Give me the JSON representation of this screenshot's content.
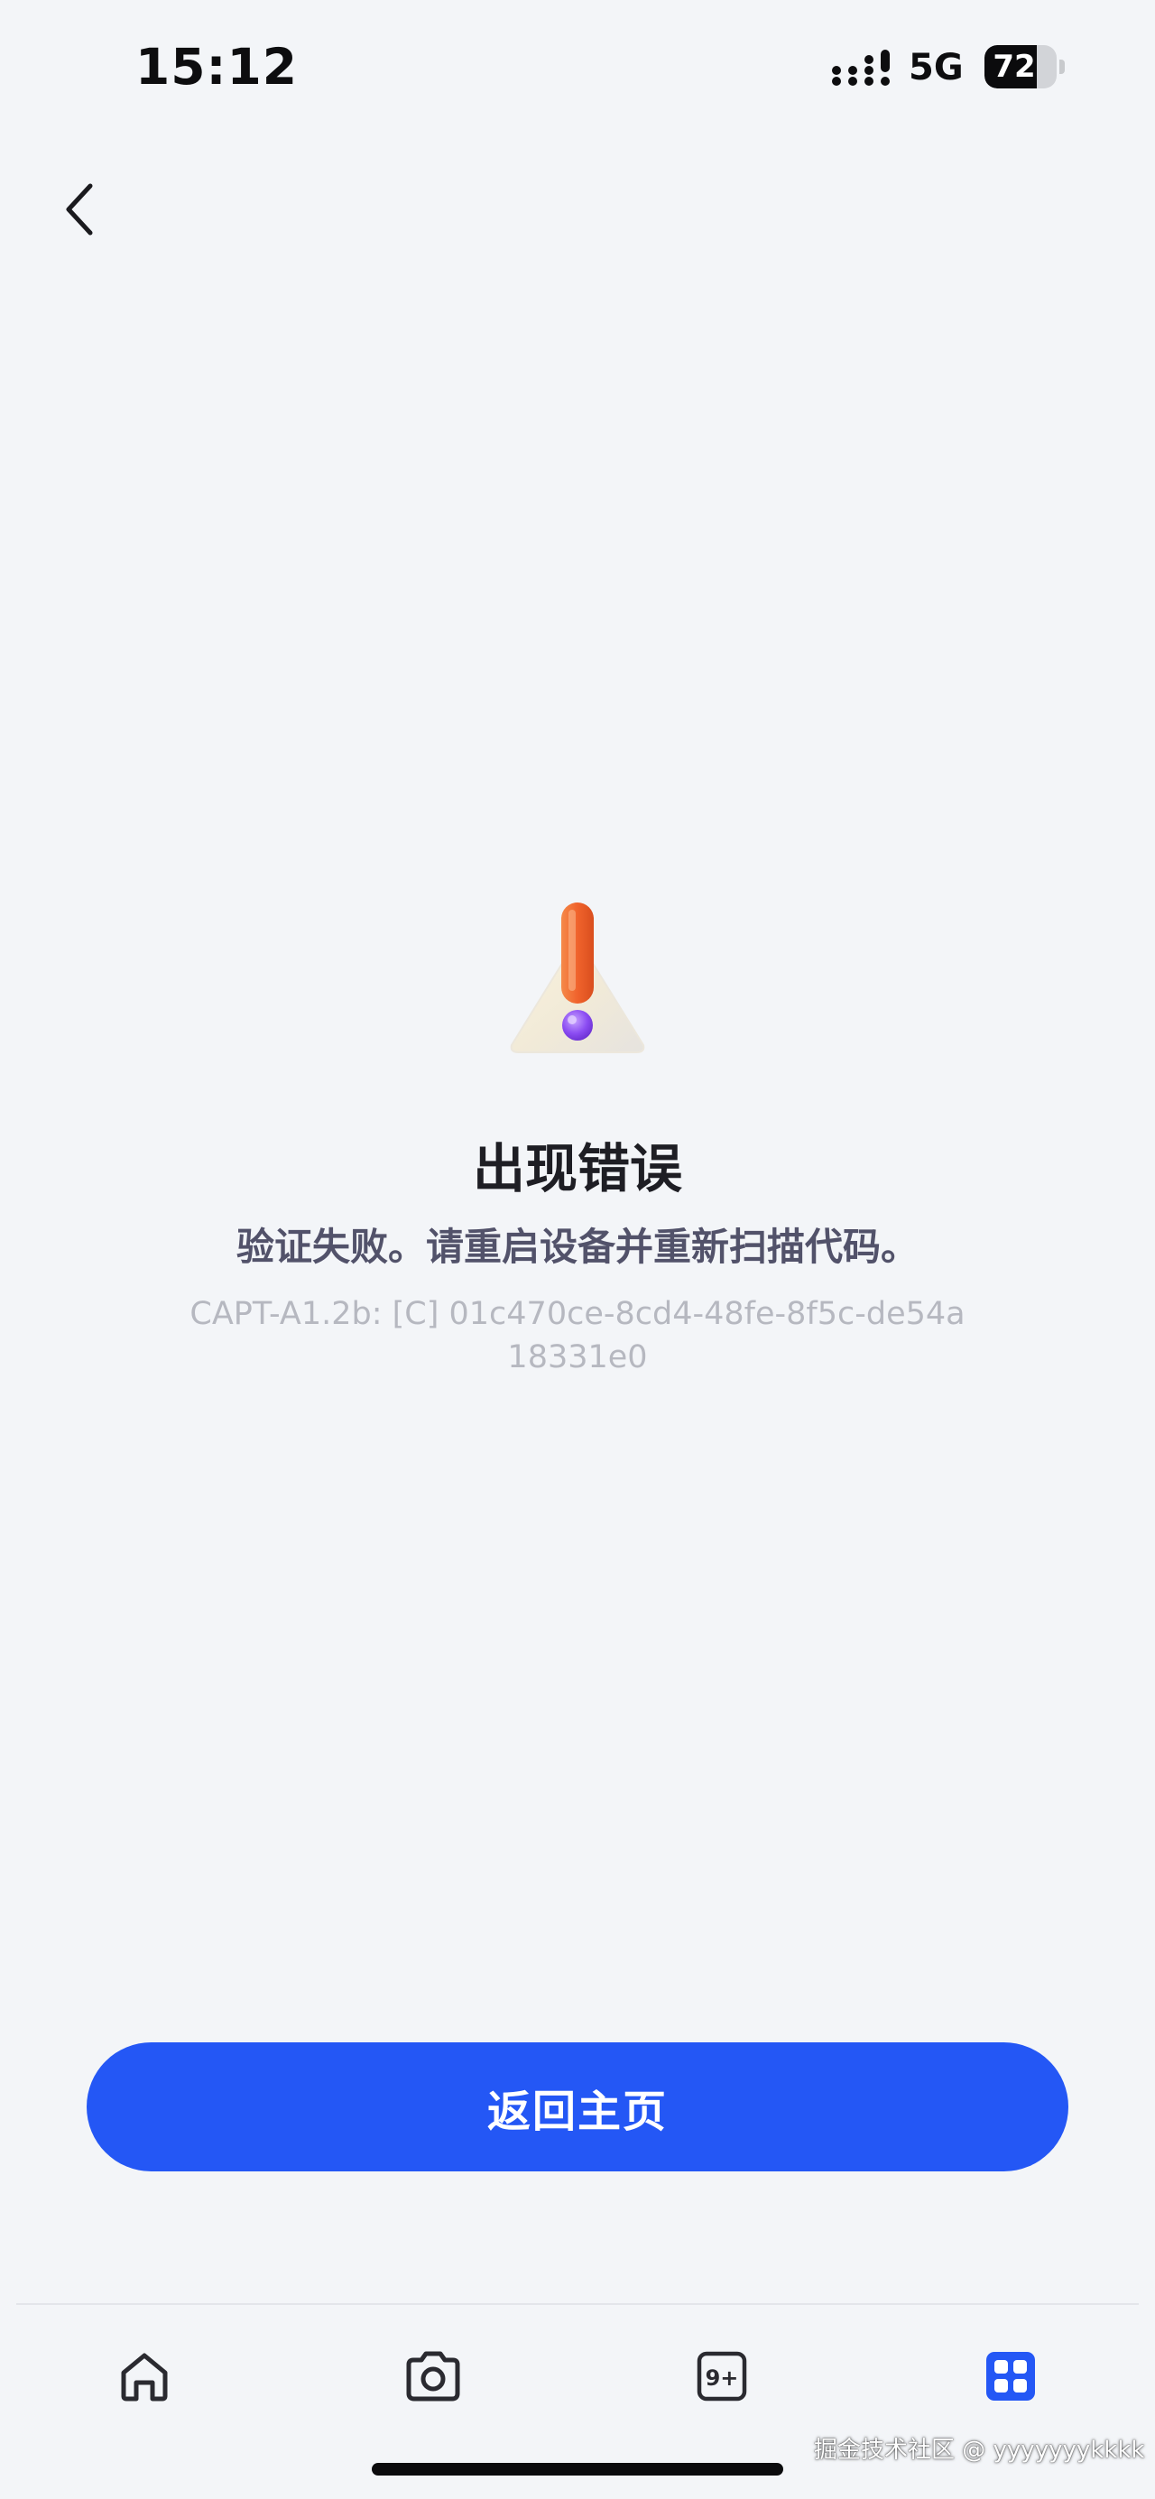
{
  "status_bar": {
    "time": "15:12",
    "network": "5G",
    "battery_level": "72",
    "battery_fraction": 0.72
  },
  "header": {
    "back_icon": "chevron-left-icon"
  },
  "error": {
    "icon": "warning-triangle-icon",
    "title": "出现错误",
    "message": "验证失败。请重启设备并重新扫描代码。",
    "code": "CAPT-A1.2b: [C] 01c470ce-8cd4-48fe-8f5c-de54a18331e0"
  },
  "action": {
    "home_button_label": "返回主页"
  },
  "tab_bar": {
    "tabs": [
      {
        "icon": "home-icon",
        "active": false
      },
      {
        "icon": "camera-icon",
        "active": false
      },
      {
        "icon": "notification-badge-icon",
        "badge_text": "9+",
        "active": false
      },
      {
        "icon": "apps-grid-icon",
        "active": true
      }
    ],
    "active_color": "#2457f5",
    "inactive_color": "#2a2a30"
  },
  "watermark": "掘金技术社区 @ yyyyyyykkkk",
  "colors": {
    "accent": "#2457f5",
    "background": "#f3f5f8",
    "warning_orange": "#f0632c",
    "warning_purple": "#8b4cf2"
  }
}
